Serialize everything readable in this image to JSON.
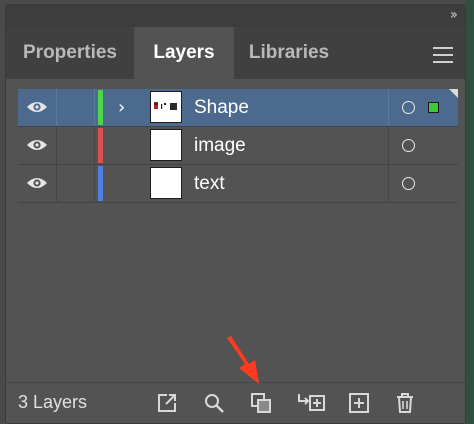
{
  "panel": {
    "tabs": [
      {
        "label": "Properties"
      },
      {
        "label": "Layers"
      },
      {
        "label": "Libraries"
      }
    ],
    "active_tab": "Layers"
  },
  "layers": [
    {
      "name": "Shape",
      "color": "#4cd64c",
      "selected": true,
      "expandable": true
    },
    {
      "name": "image",
      "color": "#e04f4f",
      "selected": false,
      "expandable": false
    },
    {
      "name": "text",
      "color": "#4f7fe0",
      "selected": false,
      "expandable": false
    }
  ],
  "footer": {
    "layer_count": "3 Layers"
  },
  "colors": {
    "panel_bg": "#535353",
    "selected_row": "#4b6a8e",
    "annotation_arrow": "#ff3b1f"
  }
}
